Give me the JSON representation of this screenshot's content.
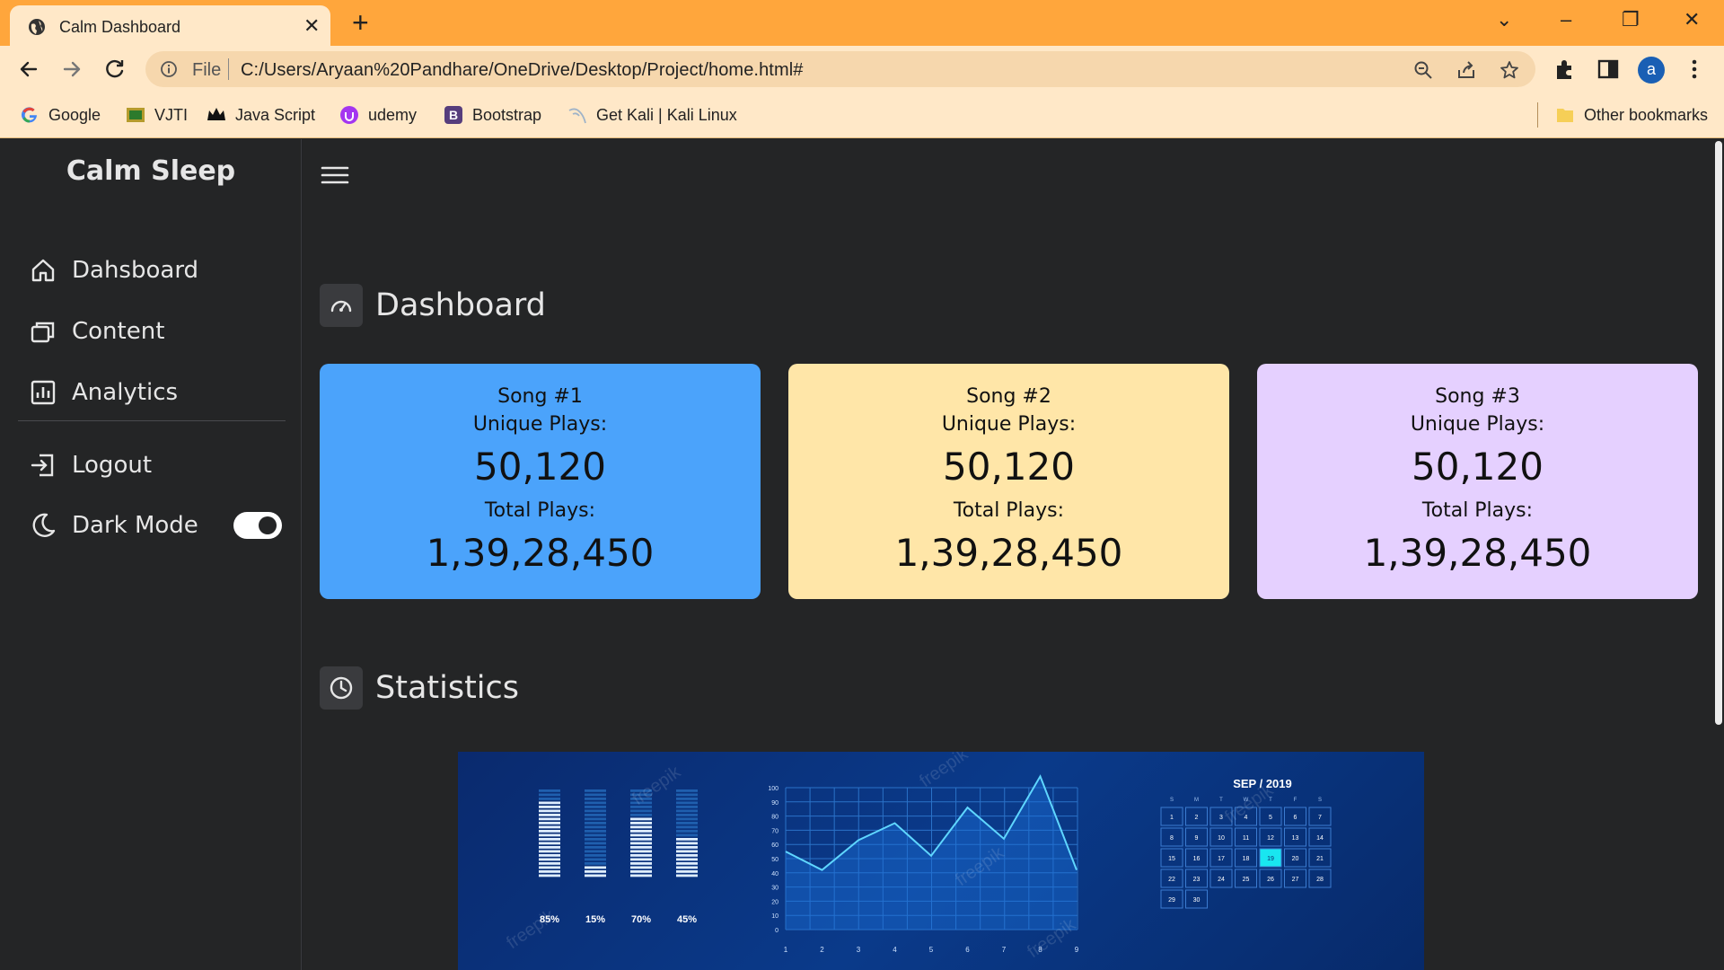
{
  "browser": {
    "tab_title": "Calm Dashboard",
    "url_scheme": "File",
    "url": "C:/Users/Aryaan%20Pandhare/OneDrive/Desktop/Project/home.html#",
    "profile_initial": "a",
    "bookmarks": [
      {
        "label": "Google",
        "icon": "google-icon"
      },
      {
        "label": "VJTI",
        "icon": "vjti-icon"
      },
      {
        "label": "Java Script",
        "icon": "crown-icon"
      },
      {
        "label": "udemy",
        "icon": "udemy-icon"
      },
      {
        "label": "Bootstrap",
        "icon": "bootstrap-icon"
      },
      {
        "label": "Get Kali | Kali Linux",
        "icon": "kali-icon"
      }
    ],
    "other_bookmarks": "Other bookmarks",
    "colors": {
      "tabstrip": "#ffa63c",
      "toolbar": "#ffe8c8"
    }
  },
  "sidebar": {
    "brand": "Calm Sleep",
    "items": [
      {
        "label": "Dahsboard",
        "icon": "home-icon"
      },
      {
        "label": "Content",
        "icon": "content-icon"
      },
      {
        "label": "Analytics",
        "icon": "analytics-icon"
      }
    ],
    "logout": "Logout",
    "dark_mode": "Dark Mode",
    "dark_mode_on": true
  },
  "main": {
    "dashboard_title": "Dashboard",
    "statistics_title": "Statistics",
    "cards": [
      {
        "song": "Song #1",
        "unique_label": "Unique Plays:",
        "unique": "50,120",
        "total_label": "Total Plays:",
        "total": "1,39,28,450",
        "color": "#4ba3fb"
      },
      {
        "song": "Song #2",
        "unique_label": "Unique Plays:",
        "unique": "50,120",
        "total_label": "Total Plays:",
        "total": "1,39,28,450",
        "color": "#ffe6a8"
      },
      {
        "song": "Song #3",
        "unique_label": "Unique Plays:",
        "unique": "50,120",
        "total_label": "Total Plays:",
        "total": "1,39,28,450",
        "color": "#e5d0ff"
      }
    ]
  },
  "stats_image": {
    "bar_labels": [
      "85%",
      "15%",
      "70%",
      "45%"
    ],
    "bar_levels": [
      0.85,
      0.15,
      0.7,
      0.45
    ],
    "line_y_ticks": [
      "100",
      "90",
      "80",
      "70",
      "60",
      "50",
      "40",
      "30",
      "20",
      "10",
      "0"
    ],
    "line_x_ticks": [
      "1",
      "2",
      "3",
      "4",
      "5",
      "6",
      "7",
      "8",
      "9"
    ],
    "line_values": [
      55,
      42,
      63,
      75,
      52,
      86,
      64,
      108,
      42
    ],
    "calendar_title": "SEP / 2019",
    "calendar_weekdays": [
      "S",
      "M",
      "T",
      "W",
      "T",
      "F",
      "S"
    ],
    "calendar_days": [
      "1",
      "2",
      "3",
      "4",
      "5",
      "6",
      "7",
      "8",
      "9",
      "10",
      "11",
      "12",
      "13",
      "14",
      "15",
      "16",
      "17",
      "18",
      "19",
      "20",
      "21",
      "22",
      "23",
      "24",
      "25",
      "26",
      "27",
      "28",
      "29",
      "30"
    ],
    "calendar_selected": "19",
    "watermark": "freepik"
  }
}
